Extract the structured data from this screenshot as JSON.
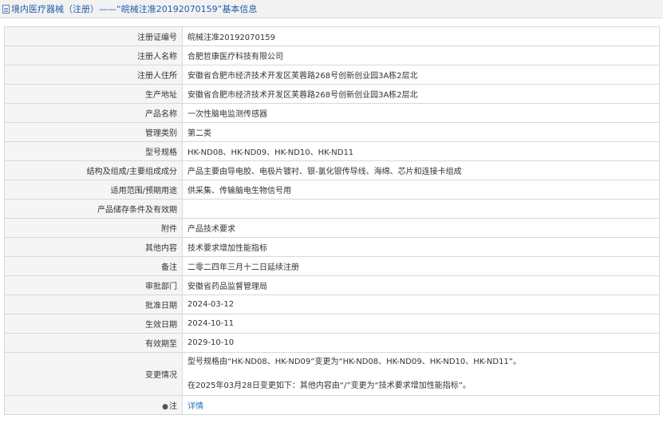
{
  "header": {
    "title": "境内医疗器械（注册）——“皖械注准20192070159”基本信息"
  },
  "rows": [
    {
      "label": "注册证编号",
      "value": "皖械注准20192070159"
    },
    {
      "label": "注册人名称",
      "value": "合肥哲康医疗科技有限公司"
    },
    {
      "label": "注册人住所",
      "value": "安徽省合肥市经济技术开发区芙蓉路268号创新创业园3A栋2层北"
    },
    {
      "label": "生产地址",
      "value": "安徽省合肥市经济技术开发区芙蓉路268号创新创业园3A栋2层北"
    },
    {
      "label": "产品名称",
      "value": "一次性脑电监测传感器"
    },
    {
      "label": "管理类别",
      "value": "第二类"
    },
    {
      "label": "型号规格",
      "value": "HK-ND08、HK-ND09、HK-ND10、HK-ND11"
    },
    {
      "label": "结构及组成/主要组成成分",
      "value": "产品主要由导电胶、电极片镀衬、银-氯化银传导线、海绵、芯片和连接卡组成"
    },
    {
      "label": "适用范围/预期用途",
      "value": "供采集、传输脑电生物信号用"
    },
    {
      "label": "产品储存条件及有效期",
      "value": ""
    },
    {
      "label": "附件",
      "value": "产品技术要求"
    },
    {
      "label": "其他内容",
      "value": "技术要求增加性能指标"
    },
    {
      "label": "备注",
      "value": "二零二四年三月十二日延续注册"
    },
    {
      "label": "审批部门",
      "value": "安徽省药品监督管理局"
    },
    {
      "label": "批准日期",
      "value": "2024-03-12"
    },
    {
      "label": "生效日期",
      "value": "2024-10-11"
    },
    {
      "label": "有效期至",
      "value": "2029-10-10"
    }
  ],
  "change": {
    "label": "变更情况",
    "lines": [
      "型号规格由“HK-ND08、HK-ND09”变更为“HK-ND08、HK-ND09、HK-ND10、HK-ND11”。",
      "在2025年03月28日变更如下：其他内容由“/”变更为“技术要求增加性能指标”。"
    ]
  },
  "note": {
    "icon": "pin-icon",
    "icon_glyph": "●",
    "label": "注",
    "link_text": "详情"
  }
}
